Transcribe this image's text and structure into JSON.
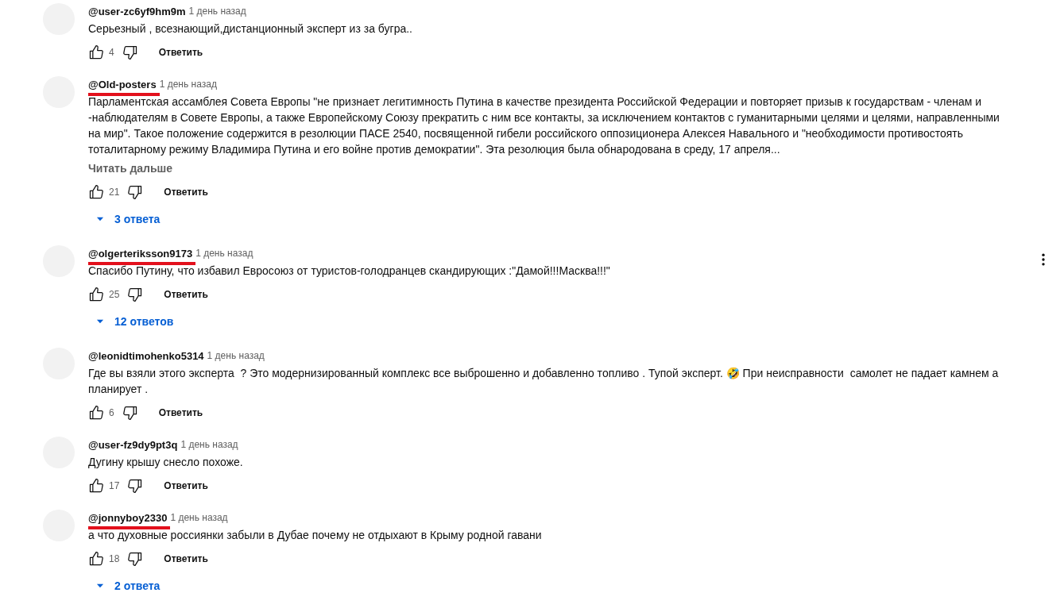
{
  "comments": [
    {
      "author": "@user-zc6yf9hm9m",
      "time": "1 день назад",
      "underlined": false,
      "hovered": false,
      "text": [
        "Серьезный , всезнающий,дистанционный эксперт из за бугра.."
      ],
      "likes": "4",
      "reply_label": "Ответить"
    },
    {
      "author": "@Old-posters",
      "time": "1 день назад",
      "underlined": true,
      "hovered": false,
      "text": [
        "Парламентская ассамблея Совета Европы \"не признает легитимность Путина в качестве президента Российской Федерации и повторяет призыв к государствам - членам и",
        "-наблюдателям в Совете Европы, а также Европейскому Союзу прекратить с ним все контакты, за исключением контактов с гуманитарными целями и целями, направленными",
        "на мир\". Такое положение содержится в резолюции ПАСЕ 2540, посвященной гибели российского оппозиционера Алексея Навального и \"необходимости противостоять",
        "тоталитарному режиму Владимира Путина и его войне против демократии\". Эта резолюция была обнародована в среду, 17 апреля..."
      ],
      "read_more": "Читать дальше",
      "likes": "21",
      "reply_label": "Ответить",
      "replies": "3 ответа"
    },
    {
      "author": "@olgerteriksson9173",
      "time": "1 день назад",
      "underlined": true,
      "hovered": true,
      "text": [
        "Спасибо Путину, что избавил Евросоюз от туристов-голодранцев скандирующих :\"Дамой!!!Масква!!!\""
      ],
      "likes": "25",
      "reply_label": "Ответить",
      "replies": "12 ответов"
    },
    {
      "author": "@leonidtimohenko5314",
      "time": "1 день назад",
      "underlined": false,
      "hovered": false,
      "text": [
        "Где вы взяли этого эксперта  ? Это модернизированный комплекс все выброшенно и добавленно топливо . Тупой эксперт. 🤣 При неисправности  самолет не падает камнем а",
        "планирует ."
      ],
      "likes": "6",
      "reply_label": "Ответить"
    },
    {
      "author": "@user-fz9dy9pt3q",
      "time": "1 день назад",
      "underlined": false,
      "hovered": false,
      "text": [
        "Дугину крышу снесло похоже."
      ],
      "likes": "17",
      "reply_label": "Ответить"
    },
    {
      "author": "@jonnyboy2330",
      "time": "1 день назад",
      "underlined": true,
      "hovered": false,
      "text": [
        "а что духовные россиянки забыли в Дубае почему не отдыхают в Крыму родной гавани"
      ],
      "likes": "18",
      "reply_label": "Ответить",
      "replies": "2 ответа"
    }
  ]
}
